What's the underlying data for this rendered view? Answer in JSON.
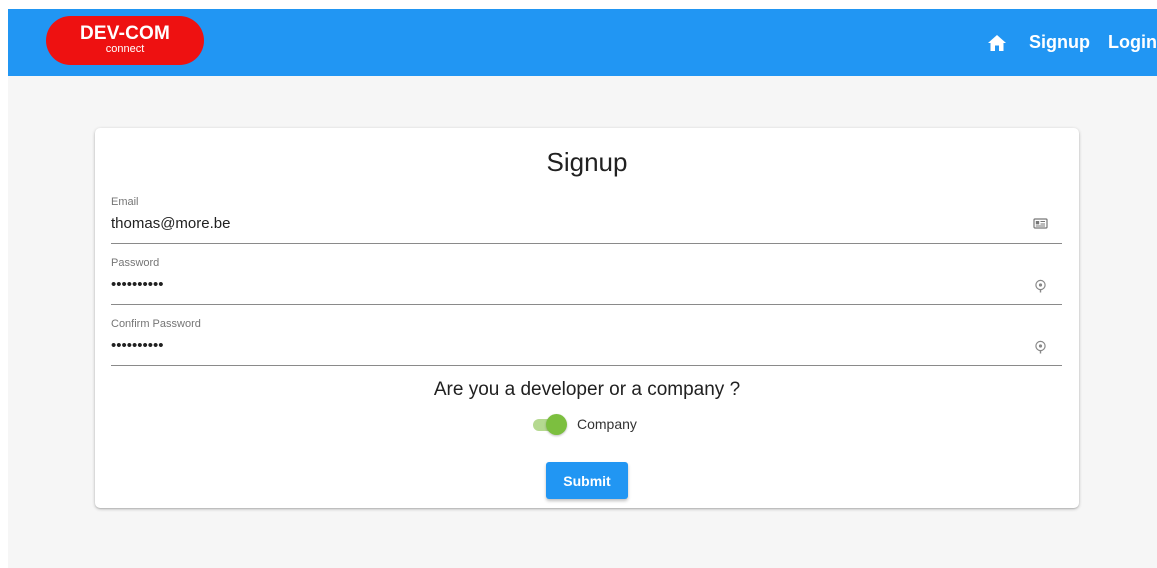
{
  "header": {
    "logo_title": "DEV-COM",
    "logo_subtitle": "connect",
    "home_icon": "home-icon",
    "nav_signup": "Signup",
    "nav_login": "Login"
  },
  "form": {
    "title": "Signup",
    "email": {
      "label": "Email",
      "value": "thomas@more.be",
      "icon": "id-card-icon"
    },
    "password": {
      "label": "Password",
      "value": "••••••••••",
      "icon": "key-icon"
    },
    "confirm_password": {
      "label": "Confirm Password",
      "value": "••••••••••",
      "icon": "key-icon"
    },
    "question": "Are you a developer or a company ?",
    "toggle": {
      "label": "Company",
      "checked": true
    },
    "submit_label": "Submit"
  },
  "colors": {
    "header_bg": "#2196f3",
    "logo_bg": "#ee1111",
    "toggle_on": "#7cbf3f",
    "button_bg": "#2196f3"
  }
}
